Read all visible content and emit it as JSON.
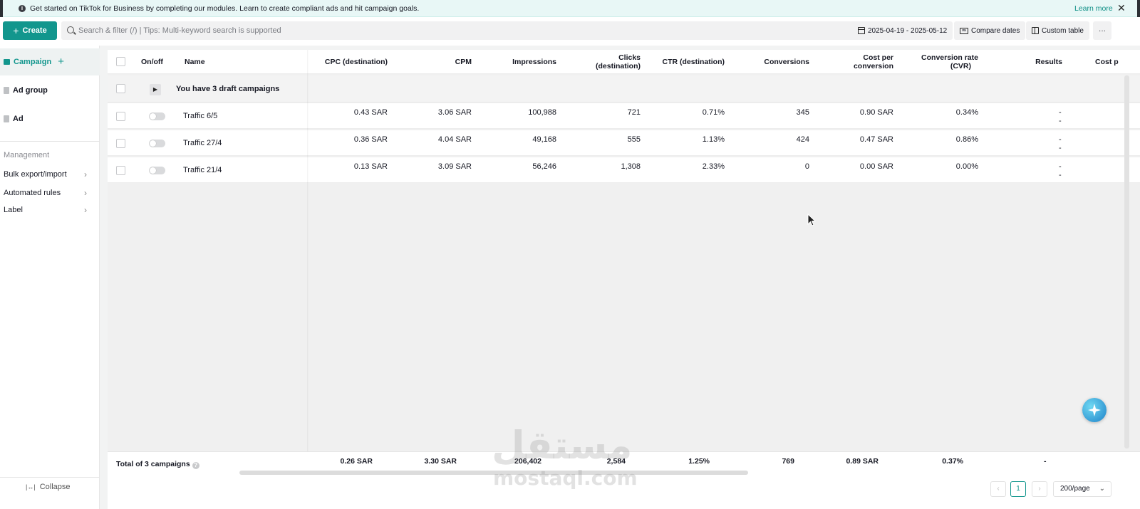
{
  "banner": {
    "text": "Get started on TikTok for Business by completing our modules. Learn to create compliant ads and hit campaign goals.",
    "learn_more": "Learn more",
    "close": "✕"
  },
  "toolbar": {
    "create_label": "Create",
    "search_placeholder": "Search & filter (/) | Tips: Multi-keyword search is supported",
    "date_range": "2025-04-19 - 2025-05-12",
    "compare_dates": "Compare dates",
    "custom_table": "Custom table",
    "more": "···",
    "vs_badge": "vs"
  },
  "sidebar": {
    "levels": [
      {
        "label": "Campaign",
        "active": true,
        "icon": "folder-icon"
      },
      {
        "label": "Ad group",
        "active": false,
        "icon": "document-icon"
      },
      {
        "label": "Ad",
        "active": false,
        "icon": "document-icon"
      }
    ],
    "management_title": "Management",
    "management_items": [
      {
        "label": "Bulk export/import"
      },
      {
        "label": "Automated rules"
      },
      {
        "label": "Label"
      }
    ],
    "collapse_label": "Collapse",
    "collapse_icon": "|↔|"
  },
  "table": {
    "headers": {
      "onoff": "On/off",
      "name": "Name",
      "cpc": "CPC (destination)",
      "cpm": "CPM",
      "impressions": "Impressions",
      "clicks_1": "Clicks",
      "clicks_2": "(destination)",
      "ctr": "CTR (destination)",
      "conversions": "Conversions",
      "cpconv_1": "Cost per",
      "cpconv_2": "conversion",
      "cvr_1": "Conversion rate",
      "cvr_2": "(CVR)",
      "results": "Results",
      "cost_per_result": "Cost p"
    },
    "draft_text": "You have 3 draft campaigns",
    "rows": [
      {
        "name": "Traffic 6/5",
        "cpc": "0.43 SAR",
        "cpm": "3.06 SAR",
        "impressions": "100,988",
        "clicks": "721",
        "ctr": "0.71%",
        "conversions": "345",
        "cost_per_conversion": "0.90 SAR",
        "cvr": "0.34%",
        "results_1": "-",
        "results_2": "-",
        "enabled": false
      },
      {
        "name": "Traffic 27/4",
        "cpc": "0.36 SAR",
        "cpm": "4.04 SAR",
        "impressions": "49,168",
        "clicks": "555",
        "ctr": "1.13%",
        "conversions": "424",
        "cost_per_conversion": "0.47 SAR",
        "cvr": "0.86%",
        "results_1": "-",
        "results_2": "-",
        "enabled": false
      },
      {
        "name": "Traffic 21/4",
        "cpc": "0.13 SAR",
        "cpm": "3.09 SAR",
        "impressions": "56,246",
        "clicks": "1,308",
        "ctr": "2.33%",
        "conversions": "0",
        "cost_per_conversion": "0.00 SAR",
        "cvr": "0.00%",
        "results_1": "-",
        "results_2": "-",
        "enabled": false
      }
    ],
    "totals": {
      "label": "Total of 3 campaigns",
      "help": "?",
      "cpc": "0.26 SAR",
      "cpm": "3.30 SAR",
      "impressions": "206,402",
      "clicks": "2,584",
      "ctr": "1.25%",
      "conversions": "769",
      "cost_per_conversion": "0.89 SAR",
      "cvr": "0.37%",
      "results": "-"
    }
  },
  "pagination": {
    "prev": "‹",
    "current_page": "1",
    "next": "›",
    "per_page": "200/page"
  },
  "watermark": {
    "arabic": "مستقل",
    "latin": "mostaql.com"
  },
  "colors": {
    "accent": "#12968d",
    "banner_bg": "#e8f7f6",
    "body_bg": "#f2f3f3"
  }
}
